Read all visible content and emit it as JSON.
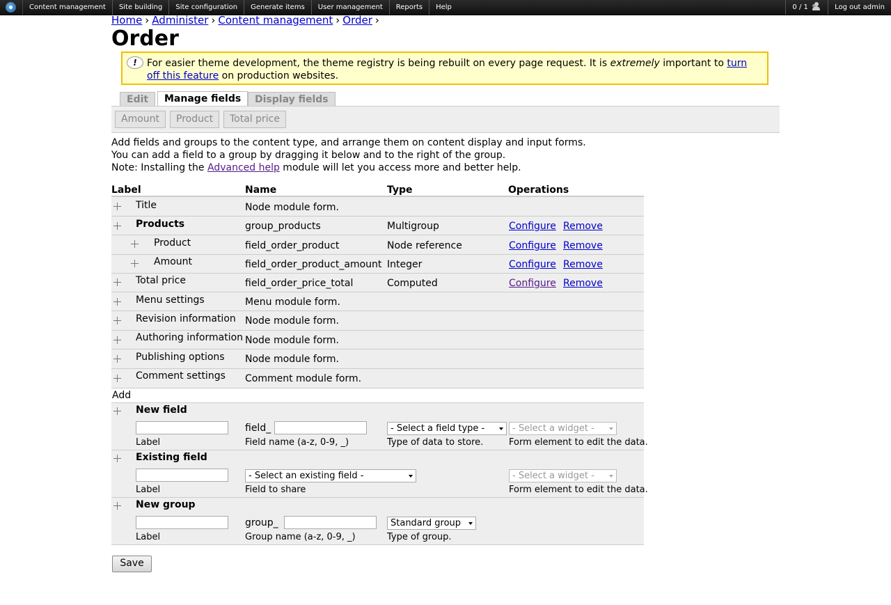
{
  "admin_bar": {
    "menu": [
      "Content management",
      "Site building",
      "Site configuration",
      "Generate items",
      "User management",
      "Reports",
      "Help"
    ],
    "user_count": "0 / 1",
    "logout": "Log out admin"
  },
  "breadcrumb": [
    "Home",
    "Administer",
    "Content management",
    "Order"
  ],
  "breadcrumb_sep": "›",
  "page_title": "Order",
  "warning": {
    "text_before": "For easier theme development, the theme registry is being rebuilt on every page request. It is ",
    "emphasis": "extremely",
    "text_middle": " important to ",
    "link": "turn off this feature",
    "text_after": " on production websites."
  },
  "tabs": [
    "Edit",
    "Manage fields",
    "Display fields"
  ],
  "subtabs": [
    "Amount",
    "Product",
    "Total price"
  ],
  "help": {
    "line1": "Add fields and groups to the content type, and arrange them on content display and input forms.",
    "line2": "You can add a field to a group by dragging it below and to the right of the group.",
    "line3_before": "Note: Installing the ",
    "line3_link": "Advanced help",
    "line3_after": " module will let you access more and better help."
  },
  "table": {
    "headers": [
      "Label",
      "Name",
      "Type",
      "Operations"
    ],
    "rows": [
      {
        "label": "Title",
        "name": "Node module form.",
        "type": "",
        "configure": "",
        "remove": ""
      },
      {
        "label": "Products",
        "name": "group_products",
        "type": "Multigroup",
        "configure": "Configure",
        "remove": "Remove"
      },
      {
        "label": "Product",
        "name": "field_order_product",
        "type": "Node reference",
        "configure": "Configure",
        "remove": "Remove"
      },
      {
        "label": "Amount",
        "name": "field_order_product_amount",
        "type": "Integer",
        "configure": "Configure",
        "remove": "Remove"
      },
      {
        "label": "Total price",
        "name": "field_order_price_total",
        "type": "Computed",
        "configure": "Configure",
        "remove": "Remove"
      },
      {
        "label": "Menu settings",
        "name": "Menu module form.",
        "type": "",
        "configure": "",
        "remove": ""
      },
      {
        "label": "Revision information",
        "name": "Node module form.",
        "type": "",
        "configure": "",
        "remove": ""
      },
      {
        "label": "Authoring information",
        "name": "Node module form.",
        "type": "",
        "configure": "",
        "remove": ""
      },
      {
        "label": "Publishing options",
        "name": "Node module form.",
        "type": "",
        "configure": "",
        "remove": ""
      },
      {
        "label": "Comment settings",
        "name": "Comment module form.",
        "type": "",
        "configure": "",
        "remove": ""
      }
    ]
  },
  "add": {
    "heading": "Add",
    "new_field": {
      "title": "New field",
      "label_caption": "Label",
      "prefix": "field_",
      "name_caption": "Field name (a-z, 0-9, _)",
      "type_select": "- Select a field type -",
      "type_caption": "Type of data to store.",
      "widget_select": "- Select a widget -",
      "widget_caption": "Form element to edit the data."
    },
    "existing_field": {
      "title": "Existing field",
      "label_caption": "Label",
      "field_select": "- Select an existing field -",
      "field_caption": "Field to share",
      "widget_select": "- Select a widget -",
      "widget_caption": "Form element to edit the data."
    },
    "new_group": {
      "title": "New group",
      "label_caption": "Label",
      "prefix": "group_",
      "name_caption": "Group name (a-z, 0-9, _)",
      "type_select": "Standard group",
      "type_caption": "Type of group."
    }
  },
  "save_label": "Save"
}
